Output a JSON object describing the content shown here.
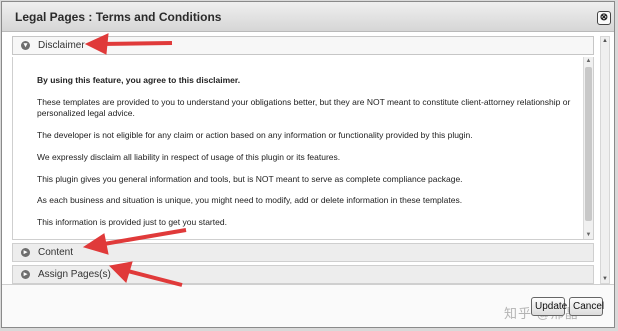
{
  "dialog": {
    "title": "Legal Pages : Terms and Conditions",
    "close_glyph": "⊗"
  },
  "accordion": {
    "disclaimer": {
      "label": "Disclaimer",
      "icon": "collapse-icon"
    },
    "content": {
      "label": "Content",
      "icon": "expand-icon"
    },
    "assign_pages": {
      "label": "Assign Pages(s)",
      "icon": "expand-icon"
    }
  },
  "disclaimer_panel": {
    "lead": "By using this feature, you agree to this disclaimer.",
    "paragraphs": [
      "These templates are provided to you to understand your obligations better, but they are NOT meant to constitute client-attorney relationship or personalized legal advice.",
      "The developer is not eligible for any claim or action based on any information or functionality provided by this plugin.",
      "We expressly disclaim all liability in respect of usage of this plugin or its features.",
      "This plugin gives you general information and tools, but is NOT meant to serve as complete compliance package.",
      "As each business and situation is unique, you might need to modify, add or delete information in these templates.",
      "This information is provided just to get you started."
    ]
  },
  "footer": {
    "update_label": "Update",
    "cancel_label": "Cancel",
    "watermark": "知乎 @邢晶"
  },
  "colors": {
    "annotation_arrow": "#e03a3a"
  }
}
